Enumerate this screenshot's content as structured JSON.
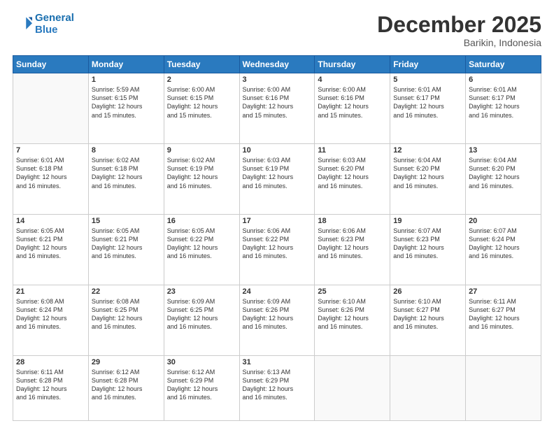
{
  "logo": {
    "line1": "General",
    "line2": "Blue"
  },
  "header": {
    "title": "December 2025",
    "subtitle": "Barikin, Indonesia"
  },
  "weekdays": [
    "Sunday",
    "Monday",
    "Tuesday",
    "Wednesday",
    "Thursday",
    "Friday",
    "Saturday"
  ],
  "weeks": [
    [
      {
        "day": "",
        "info": ""
      },
      {
        "day": "1",
        "info": "Sunrise: 5:59 AM\nSunset: 6:15 PM\nDaylight: 12 hours\nand 15 minutes."
      },
      {
        "day": "2",
        "info": "Sunrise: 6:00 AM\nSunset: 6:15 PM\nDaylight: 12 hours\nand 15 minutes."
      },
      {
        "day": "3",
        "info": "Sunrise: 6:00 AM\nSunset: 6:16 PM\nDaylight: 12 hours\nand 15 minutes."
      },
      {
        "day": "4",
        "info": "Sunrise: 6:00 AM\nSunset: 6:16 PM\nDaylight: 12 hours\nand 15 minutes."
      },
      {
        "day": "5",
        "info": "Sunrise: 6:01 AM\nSunset: 6:17 PM\nDaylight: 12 hours\nand 16 minutes."
      },
      {
        "day": "6",
        "info": "Sunrise: 6:01 AM\nSunset: 6:17 PM\nDaylight: 12 hours\nand 16 minutes."
      }
    ],
    [
      {
        "day": "7",
        "info": ""
      },
      {
        "day": "8",
        "info": "Sunrise: 6:02 AM\nSunset: 6:18 PM\nDaylight: 12 hours\nand 16 minutes."
      },
      {
        "day": "9",
        "info": "Sunrise: 6:02 AM\nSunset: 6:19 PM\nDaylight: 12 hours\nand 16 minutes."
      },
      {
        "day": "10",
        "info": "Sunrise: 6:03 AM\nSunset: 6:19 PM\nDaylight: 12 hours\nand 16 minutes."
      },
      {
        "day": "11",
        "info": "Sunrise: 6:03 AM\nSunset: 6:20 PM\nDaylight: 12 hours\nand 16 minutes."
      },
      {
        "day": "12",
        "info": "Sunrise: 6:04 AM\nSunset: 6:20 PM\nDaylight: 12 hours\nand 16 minutes."
      },
      {
        "day": "13",
        "info": "Sunrise: 6:04 AM\nSunset: 6:20 PM\nDaylight: 12 hours\nand 16 minutes."
      }
    ],
    [
      {
        "day": "14",
        "info": ""
      },
      {
        "day": "15",
        "info": "Sunrise: 6:05 AM\nSunset: 6:21 PM\nDaylight: 12 hours\nand 16 minutes."
      },
      {
        "day": "16",
        "info": "Sunrise: 6:05 AM\nSunset: 6:22 PM\nDaylight: 12 hours\nand 16 minutes."
      },
      {
        "day": "17",
        "info": "Sunrise: 6:06 AM\nSunset: 6:22 PM\nDaylight: 12 hours\nand 16 minutes."
      },
      {
        "day": "18",
        "info": "Sunrise: 6:06 AM\nSunset: 6:23 PM\nDaylight: 12 hours\nand 16 minutes."
      },
      {
        "day": "19",
        "info": "Sunrise: 6:07 AM\nSunset: 6:23 PM\nDaylight: 12 hours\nand 16 minutes."
      },
      {
        "day": "20",
        "info": "Sunrise: 6:07 AM\nSunset: 6:24 PM\nDaylight: 12 hours\nand 16 minutes."
      }
    ],
    [
      {
        "day": "21",
        "info": ""
      },
      {
        "day": "22",
        "info": "Sunrise: 6:08 AM\nSunset: 6:25 PM\nDaylight: 12 hours\nand 16 minutes."
      },
      {
        "day": "23",
        "info": "Sunrise: 6:09 AM\nSunset: 6:25 PM\nDaylight: 12 hours\nand 16 minutes."
      },
      {
        "day": "24",
        "info": "Sunrise: 6:09 AM\nSunset: 6:26 PM\nDaylight: 12 hours\nand 16 minutes."
      },
      {
        "day": "25",
        "info": "Sunrise: 6:10 AM\nSunset: 6:26 PM\nDaylight: 12 hours\nand 16 minutes."
      },
      {
        "day": "26",
        "info": "Sunrise: 6:10 AM\nSunset: 6:27 PM\nDaylight: 12 hours\nand 16 minutes."
      },
      {
        "day": "27",
        "info": "Sunrise: 6:11 AM\nSunset: 6:27 PM\nDaylight: 12 hours\nand 16 minutes."
      }
    ],
    [
      {
        "day": "28",
        "info": "Sunrise: 6:11 AM\nSunset: 6:28 PM\nDaylight: 12 hours\nand 16 minutes."
      },
      {
        "day": "29",
        "info": "Sunrise: 6:12 AM\nSunset: 6:28 PM\nDaylight: 12 hours\nand 16 minutes."
      },
      {
        "day": "30",
        "info": "Sunrise: 6:12 AM\nSunset: 6:29 PM\nDaylight: 12 hours\nand 16 minutes."
      },
      {
        "day": "31",
        "info": "Sunrise: 6:13 AM\nSunset: 6:29 PM\nDaylight: 12 hours\nand 16 minutes."
      },
      {
        "day": "",
        "info": ""
      },
      {
        "day": "",
        "info": ""
      },
      {
        "day": "",
        "info": ""
      }
    ]
  ],
  "week1_sunday_info": "Sunrise: 6:01 AM\nSunset: 6:18 PM\nDaylight: 12 hours\nand 16 minutes.",
  "week2_sunday_info": "Sunrise: 6:05 AM\nSunset: 6:21 PM\nDaylight: 12 hours\nand 16 minutes.",
  "week3_sunday_info": "Sunrise: 6:08 AM\nSunset: 6:24 PM\nDaylight: 12 hours\nand 16 minutes."
}
